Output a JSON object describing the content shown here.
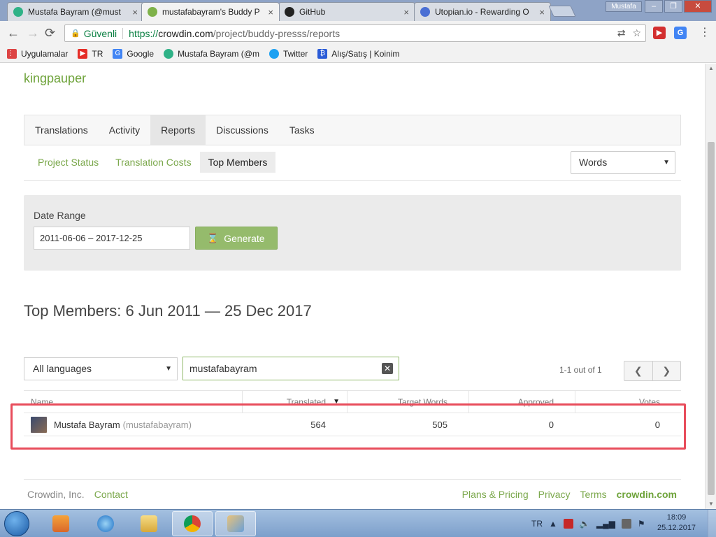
{
  "browser": {
    "tabs": [
      {
        "title": "Mustafa Bayram (@must",
        "active": false,
        "favicon_color": "#2fb287"
      },
      {
        "title": "mustafabayram's Buddy P",
        "active": true,
        "favicon_color": "#7fb24a"
      },
      {
        "title": "GitHub",
        "active": false,
        "favicon_color": "#222222"
      },
      {
        "title": "Utopian.io - Rewarding O",
        "active": false,
        "favicon_color": "#4a6fd4"
      }
    ],
    "close_glyph": "×",
    "user_badge": "Mustafa",
    "window_buttons": {
      "minimize": "–",
      "maximize": "❐",
      "close": "✕"
    },
    "nav": {
      "back": "←",
      "forward": "→",
      "reload": "⟳"
    },
    "address": {
      "secure_label": "Güvenli",
      "url_proto": "https://",
      "url_host": "crowdin.com",
      "url_path": "/project/buddy-presss/reports"
    },
    "bookmarks": [
      {
        "label": "Uygulamalar",
        "icon": "apps-grid-icon",
        "color": "#d44"
      },
      {
        "label": "TR",
        "icon": "youtube-icon",
        "color": "#e52d27"
      },
      {
        "label": "Google",
        "icon": "google-icon",
        "color": "#4285f4"
      },
      {
        "label": "Mustafa Bayram (@m",
        "icon": "steemit-icon",
        "color": "#2fb287"
      },
      {
        "label": "Twitter",
        "icon": "twitter-icon",
        "color": "#1da1f2"
      },
      {
        "label": "Alış/Satış | Koinim",
        "icon": "koinim-icon",
        "color": "#2a5bd7"
      }
    ]
  },
  "page": {
    "username": "kingpauper",
    "main_tabs": [
      {
        "label": "Translations",
        "active": false
      },
      {
        "label": "Activity",
        "active": false
      },
      {
        "label": "Reports",
        "active": true
      },
      {
        "label": "Discussions",
        "active": false
      },
      {
        "label": "Tasks",
        "active": false
      }
    ],
    "sub_tabs": [
      {
        "label": "Project Status",
        "active": false
      },
      {
        "label": "Translation Costs",
        "active": false
      },
      {
        "label": "Top Members",
        "active": true
      }
    ],
    "units_select": "Words",
    "date_range": {
      "label": "Date Range",
      "value": "2011-06-06 – 2017-12-25",
      "generate_label": "Generate"
    },
    "report_title": "Top Members: 6 Jun 2011 — 25 Dec 2017",
    "filters": {
      "language": "All languages",
      "search_value": "mustafabayram",
      "pager_text": "1-1 out of 1"
    },
    "table": {
      "headers": [
        "Name",
        "Translated",
        "Target Words",
        "Approved",
        "Votes"
      ],
      "rows": [
        {
          "name": "Mustafa Bayram",
          "handle": "(mustafabayram)",
          "translated": "564",
          "target_words": "505",
          "approved": "0",
          "votes": "0"
        }
      ]
    },
    "footer": {
      "company": "Crowdin, Inc.",
      "contact": "Contact",
      "links": [
        "Plans & Pricing",
        "Privacy",
        "Terms"
      ],
      "brand": "crowdin.com"
    },
    "highlight_color": "#e84c5b",
    "accent_color": "#7ba84c"
  },
  "taskbar": {
    "language": "TR",
    "time": "18:09",
    "date": "25.12.2017"
  }
}
